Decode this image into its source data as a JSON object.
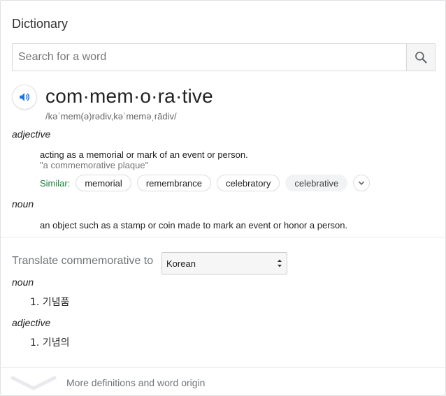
{
  "header": {
    "title": "Dictionary"
  },
  "search": {
    "placeholder": "Search for a word"
  },
  "entry": {
    "word": "com·mem·o·ra·tive",
    "phonetic": "/kəˈmem(ə)rədiv,kəˈmeməˌrādiv/",
    "senses": [
      {
        "pos": "adjective",
        "definition": "acting as a memorial or mark of an event or person.",
        "example": "\"a commemorative plaque\"",
        "similar_label": "Similar:",
        "similar": [
          "memorial",
          "remembrance",
          "celebratory",
          "celebrative"
        ]
      },
      {
        "pos": "noun",
        "definition": "an object such as a stamp or coin made to mark an event or honor a person."
      }
    ]
  },
  "translate": {
    "label": "Translate commemorative to",
    "language": "Korean",
    "groups": [
      {
        "pos": "noun",
        "items": [
          "1. 기념품"
        ]
      },
      {
        "pos": "adjective",
        "items": [
          "1. 기념의"
        ]
      }
    ]
  },
  "footer": {
    "more_label": "More definitions and word origin"
  },
  "icons": {
    "search": "search-icon",
    "speaker": "speaker-icon",
    "expand": "chevron-down-icon",
    "select": "select-arrows-icon",
    "more": "chevron-down-icon"
  },
  "colors": {
    "accent": "#1a73e8",
    "similar": "#188038",
    "muted": "#70757a"
  }
}
